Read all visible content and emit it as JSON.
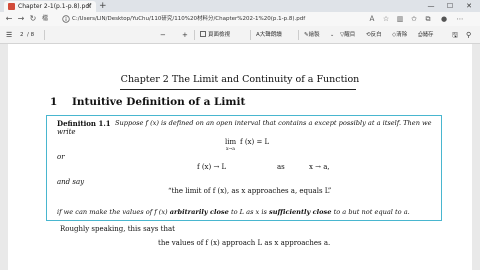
{
  "browser": {
    "tab_title": "Chapter 2-1(p.1-p.8).pdf",
    "tab_close": "×",
    "new_tab": "+",
    "url": "C:/Users/LIN/Desktop/YuChu/110研究/110%20材料分/Chapter%202-1%20(p.1-p.8).pdf",
    "url_scheme_label": "檔案",
    "window_minimize": "—",
    "window_maximize": "☐",
    "window_close": "✕"
  },
  "pdf_toolbar": {
    "page_current": "2",
    "page_total": "/ 8",
    "zoom_out": "−",
    "zoom_in": "+",
    "page_view": "頁面檢視",
    "read_aloud": "大聲朗讀",
    "draw": "繪製",
    "highlight": "醒目",
    "erase": "清除",
    "rotate": "反白",
    "print_label": "儲存"
  },
  "document": {
    "chapter_title": "Chapter 2 The Limit and Continuity of a Function",
    "section_number": "1",
    "section_title": "Intuitive Definition of a Limit",
    "definition": {
      "label": "Definition 1.1",
      "intro_line1": "Suppose f (x) is defined on an open interval that contains a except possibly at a itself.  Then we",
      "intro_line2": "write",
      "lim_word": "lim",
      "lim_sub": "x→a",
      "lim_expr": "f (x) = L",
      "or": "or",
      "arrow_left": "f (x) → L",
      "as_word": "as",
      "arrow_right": "x → a,",
      "and_say": "and say",
      "quote": "“the limit of f (x), as x approaches a, equals L”",
      "cond_1": "if we can make the values of f (x)",
      "cond_bold1": "arbitrarily close",
      "cond_2": "to L as x is",
      "cond_bold2": "sufficiently close",
      "cond_3": "to a but not equal to a."
    },
    "roughly": "Roughly speaking, this says that",
    "values_line": "the values of f (x)  approach L as x approaches a."
  }
}
